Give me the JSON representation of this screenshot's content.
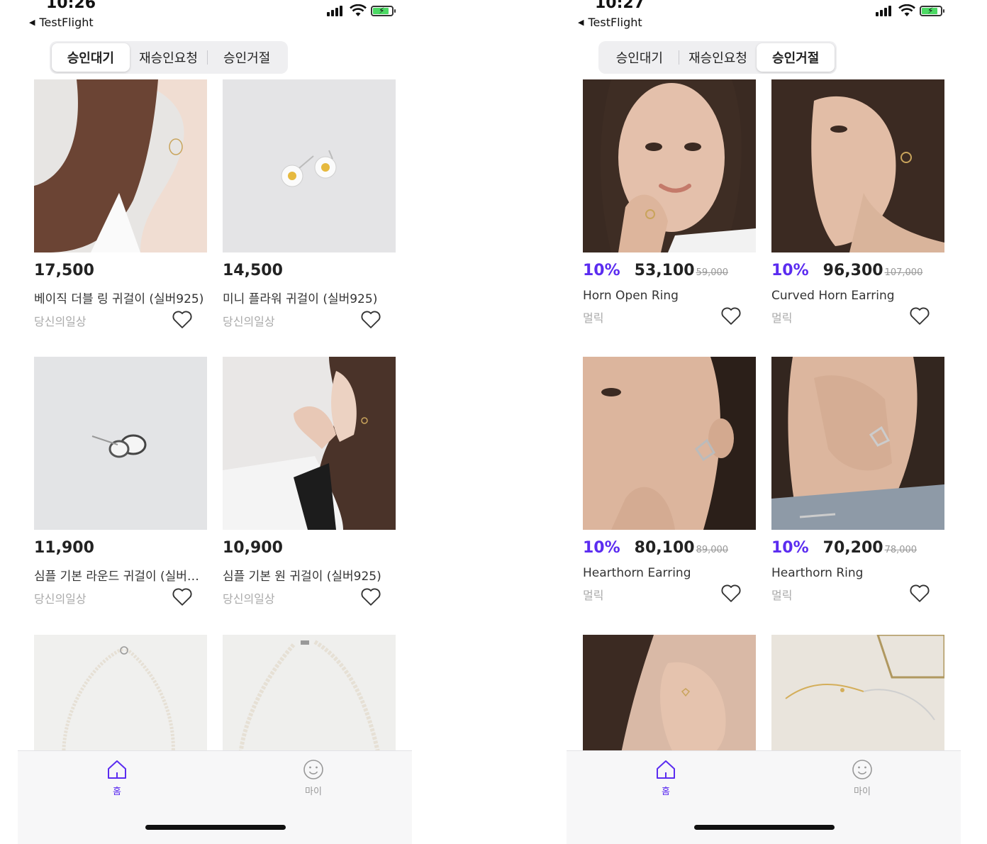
{
  "colors": {
    "accent": "#5b2cf0",
    "muted": "#aaaaaa",
    "strike": "#999999"
  },
  "screens": [
    {
      "status": {
        "time": "10:26",
        "back_label": "TestFlight"
      },
      "segments": [
        {
          "label": "승인대기",
          "selected": true
        },
        {
          "label": "재승인요청",
          "selected": false
        },
        {
          "label": "승인거절",
          "selected": false
        }
      ],
      "products": [
        {
          "price": "17,500",
          "name": "베이직 더블 링 귀걸이 (실버925)",
          "shop": "당신의일상",
          "image": "model-with-hoop-earring"
        },
        {
          "price": "14,500",
          "name": "미니 플라워 귀걸이 (실버925)",
          "shop": "당신의일상",
          "image": "daisy-stud-earrings"
        },
        {
          "price": "11,900",
          "name": "심플 기본 라운드 귀걸이 (실버…",
          "shop": "당신의일상",
          "image": "silver-round-earrings"
        },
        {
          "price": "10,900",
          "name": "심플 기본 원 귀걸이 (실버925)",
          "shop": "당신의일상",
          "image": "model-with-circle-earring"
        },
        {
          "image": "pearl-necklace"
        },
        {
          "image": "pearl-necklace"
        }
      ],
      "tabbar": {
        "home_label": "홈",
        "my_label": "마이"
      }
    },
    {
      "status": {
        "time": "10:27",
        "back_label": "TestFlight"
      },
      "segments": [
        {
          "label": "승인대기",
          "selected": false
        },
        {
          "label": "재승인요청",
          "selected": false
        },
        {
          "label": "승인거절",
          "selected": true
        }
      ],
      "products": [
        {
          "discount": "10%",
          "price": "53,100",
          "original_price": "59,000",
          "name": "Horn Open Ring",
          "shop": "멀릭",
          "image": "model-portrait-ring"
        },
        {
          "discount": "10%",
          "price": "96,300",
          "original_price": "107,000",
          "name": "Curved Horn Earring",
          "shop": "멀릭",
          "image": "model-profile-earring"
        },
        {
          "discount": "10%",
          "price": "80,100",
          "original_price": "89,000",
          "name": "Hearthorn Earring",
          "shop": "멀릭",
          "image": "model-hearthorn-earring"
        },
        {
          "discount": "10%",
          "price": "70,200",
          "original_price": "78,000",
          "name": "Hearthorn Ring",
          "shop": "멀릭",
          "image": "model-hand-ring"
        },
        {
          "image": "ear-closeup"
        },
        {
          "image": "gold-silver-necklaces"
        }
      ],
      "tabbar": {
        "home_label": "홈",
        "my_label": "마이"
      }
    }
  ]
}
